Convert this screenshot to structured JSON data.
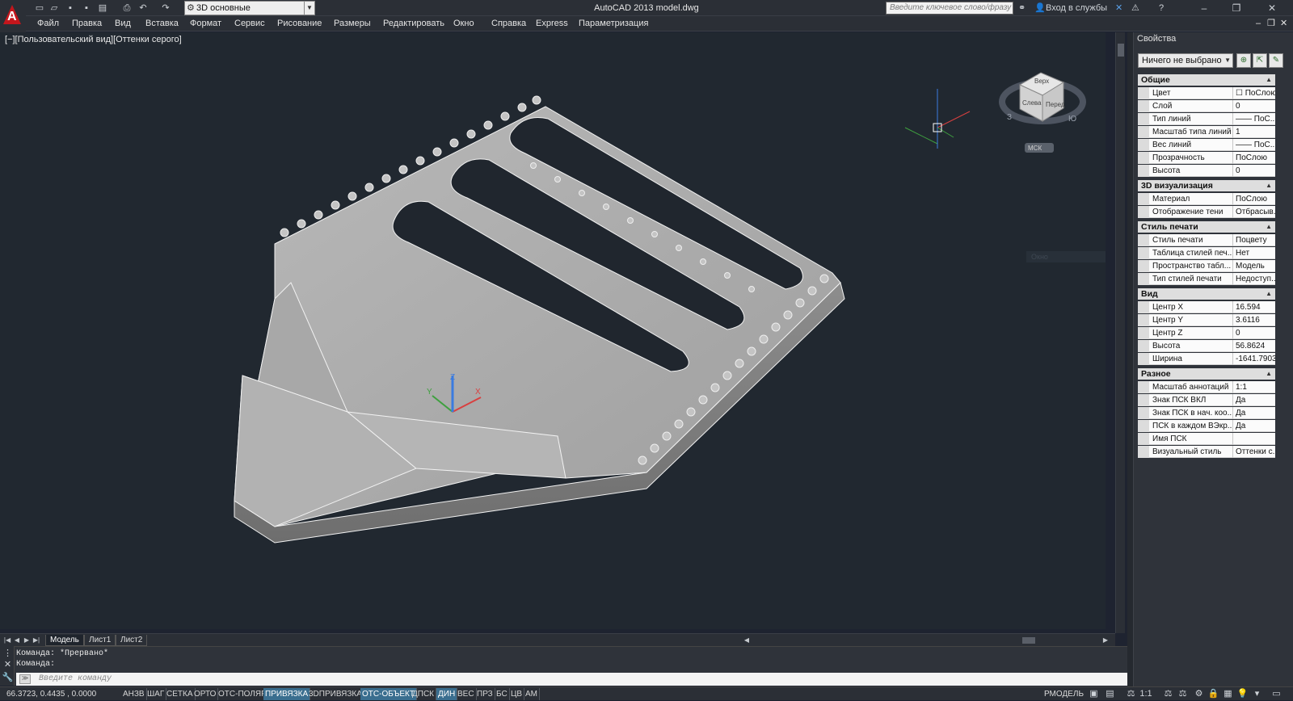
{
  "window": {
    "title": "AutoCAD 2013    model.dwg",
    "workspace": "3D основные",
    "search_placeholder": "Введите ключевое слово/фразу",
    "sign_in": "Вход в службы"
  },
  "menu": {
    "items": [
      "Файл",
      "Правка",
      "Вид",
      "Вставка",
      "Формат",
      "Сервис",
      "Рисование",
      "Размеры",
      "Редактировать",
      "Окно",
      "Справка",
      "Express",
      "Параметризация"
    ]
  },
  "viewport": {
    "label": "[−][Пользовательский вид][Оттенки серого]",
    "viewcube": {
      "top": "Верх",
      "left": "Слева",
      "front": "Перед",
      "compass_w": "З",
      "compass_s": "Ю",
      "wcs": "МСК"
    },
    "ucs": {
      "x": "X",
      "y": "Y",
      "z": "Z"
    },
    "ghost_menu": "Окно"
  },
  "tabs": {
    "items": [
      "Модель",
      "Лист1",
      "Лист2"
    ],
    "active": "Модель"
  },
  "command": {
    "history": [
      "Команда: *Прервано*",
      "Команда:"
    ],
    "placeholder": "Введите команду"
  },
  "status": {
    "coords": "66.3723, 0.4435 , 0.0000",
    "toggles": [
      {
        "label": "АНЗВ",
        "on": false
      },
      {
        "label": "ШАГ",
        "on": false
      },
      {
        "label": "СЕТКА",
        "on": false
      },
      {
        "label": "ОРТО",
        "on": false
      },
      {
        "label": "ОТС-ПОЛЯР",
        "on": false
      },
      {
        "label": "ПРИВЯЗКА",
        "on": true
      },
      {
        "label": "3DПРИВЯЗКА",
        "on": false
      },
      {
        "label": "ОТС-ОБЪЕКТ",
        "on": true
      },
      {
        "label": "ДПСК",
        "on": false
      },
      {
        "label": "ДИН",
        "on": true
      },
      {
        "label": "ВЕС",
        "on": false
      },
      {
        "label": "ПРЗ",
        "on": false
      },
      {
        "label": "БС",
        "on": false
      },
      {
        "label": "ЦВ",
        "on": false
      },
      {
        "label": "АМ",
        "on": false
      }
    ],
    "model_label": "РМОДЕЛЬ",
    "annotation_scale": "1:1"
  },
  "properties": {
    "title": "Свойства",
    "selection": "Ничего не выбрано",
    "sections": [
      {
        "name": "Общие",
        "rows": [
          {
            "name": "Цвет",
            "value": "☐ ПоСлою"
          },
          {
            "name": "Слой",
            "value": "0"
          },
          {
            "name": "Тип линий",
            "value": "—— ПоС..."
          },
          {
            "name": "Масштаб типа линий",
            "value": "1"
          },
          {
            "name": "Вес линий",
            "value": "—— ПоС..."
          },
          {
            "name": "Прозрачность",
            "value": "ПоСлою"
          },
          {
            "name": "Высота",
            "value": "0"
          }
        ]
      },
      {
        "name": "3D визуализация",
        "rows": [
          {
            "name": "Материал",
            "value": "ПоСлою"
          },
          {
            "name": "Отображение тени",
            "value": "Отбрасыв..."
          }
        ]
      },
      {
        "name": "Стиль печати",
        "rows": [
          {
            "name": "Стиль печати",
            "value": "Поцвету"
          },
          {
            "name": "Таблица стилей печ...",
            "value": "Нет"
          },
          {
            "name": "Пространство табл...",
            "value": "Модель"
          },
          {
            "name": "Тип стилей печати",
            "value": "Недоступ..."
          }
        ]
      },
      {
        "name": "Вид",
        "rows": [
          {
            "name": "Центр X",
            "value": "16.594"
          },
          {
            "name": "Центр Y",
            "value": "3.6116"
          },
          {
            "name": "Центр Z",
            "value": "0"
          },
          {
            "name": "Высота",
            "value": "56.8624"
          },
          {
            "name": "Ширина",
            "value": "-1641.7903"
          }
        ]
      },
      {
        "name": "Разное",
        "rows": [
          {
            "name": "Масштаб аннотаций",
            "value": "1:1"
          },
          {
            "name": "Знак ПСК ВКЛ",
            "value": "Да"
          },
          {
            "name": "Знак ПСК в нач. коо...",
            "value": "Да"
          },
          {
            "name": "ПСК в каждом ВЭкр...",
            "value": "Да"
          },
          {
            "name": "Имя ПСК",
            "value": ""
          },
          {
            "name": "Визуальный стиль",
            "value": "Оттенки с..."
          }
        ]
      }
    ]
  },
  "colors": {
    "viewport_bg": "#212830",
    "panel_bg": "#2f333a",
    "toggle_on": "#3a6e8f",
    "logo_red": "#c4161c"
  }
}
